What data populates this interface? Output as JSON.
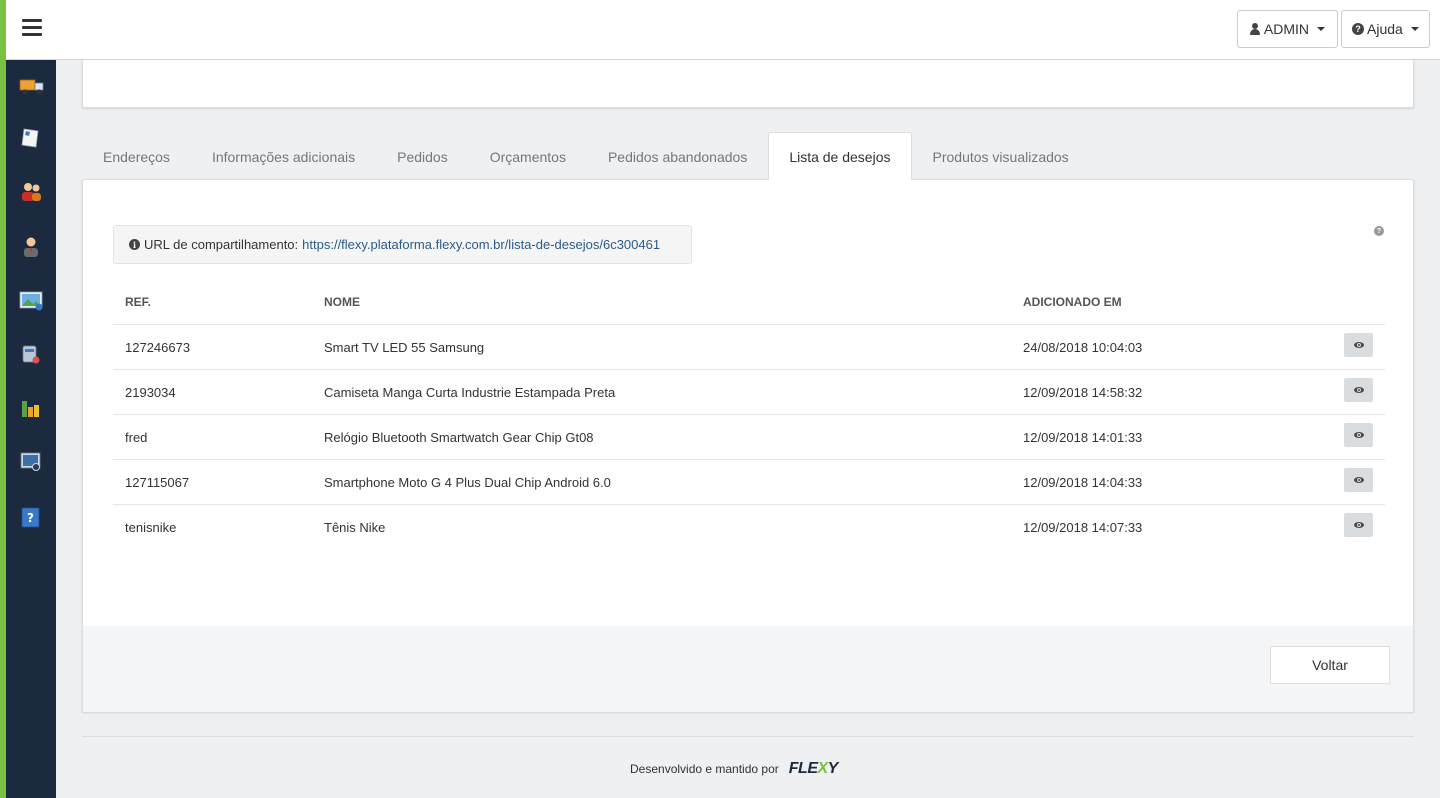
{
  "header": {
    "user_label": "ADMIN",
    "help_label": "Ajuda"
  },
  "sidebar": {
    "items": [
      {
        "name": "truck-icon"
      },
      {
        "name": "document-icon"
      },
      {
        "name": "customers-icon"
      },
      {
        "name": "user-icon"
      },
      {
        "name": "image-icon"
      },
      {
        "name": "database-icon"
      },
      {
        "name": "chart-icon"
      },
      {
        "name": "monitor-icon"
      },
      {
        "name": "help-icon"
      }
    ]
  },
  "tabs": [
    {
      "label": "Endereços",
      "active": false
    },
    {
      "label": "Informações adicionais",
      "active": false
    },
    {
      "label": "Pedidos",
      "active": false
    },
    {
      "label": "Orçamentos",
      "active": false
    },
    {
      "label": "Pedidos abandonados",
      "active": false
    },
    {
      "label": "Lista de desejos",
      "active": true
    },
    {
      "label": "Produtos visualizados",
      "active": false
    }
  ],
  "share": {
    "label": "URL de compartilhamento:",
    "url": "https://flexy.plataforma.flexy.com.br/lista-de-desejos/6c300461"
  },
  "table": {
    "headers": {
      "ref": "REF.",
      "name": "NOME",
      "date": "ADICIONADO EM"
    },
    "rows": [
      {
        "ref": "127246673",
        "name": "Smart TV LED 55 Samsung",
        "date": "24/08/2018 10:04:03"
      },
      {
        "ref": "2193034",
        "name": "Camiseta Manga Curta Industrie Estampada Preta",
        "date": "12/09/2018 14:58:32"
      },
      {
        "ref": "fred",
        "name": "Relógio Bluetooth Smartwatch Gear Chip Gt08",
        "date": "12/09/2018 14:01:33"
      },
      {
        "ref": "127115067",
        "name": "Smartphone Moto G 4 Plus Dual Chip Android 6.0",
        "date": "12/09/2018 14:04:33"
      },
      {
        "ref": "tenisnike",
        "name": "Tênis Nike",
        "date": "12/09/2018 14:07:33"
      }
    ]
  },
  "actions": {
    "back_label": "Voltar"
  },
  "footer": {
    "text": "Desenvolvido e mantido por",
    "brand_prefix": "FLE",
    "brand_x": "X",
    "brand_suffix": "Y"
  },
  "colors": {
    "accent_green": "#7ac142",
    "sidebar_bg": "#1c2a3f",
    "link": "#2a5a8c"
  }
}
